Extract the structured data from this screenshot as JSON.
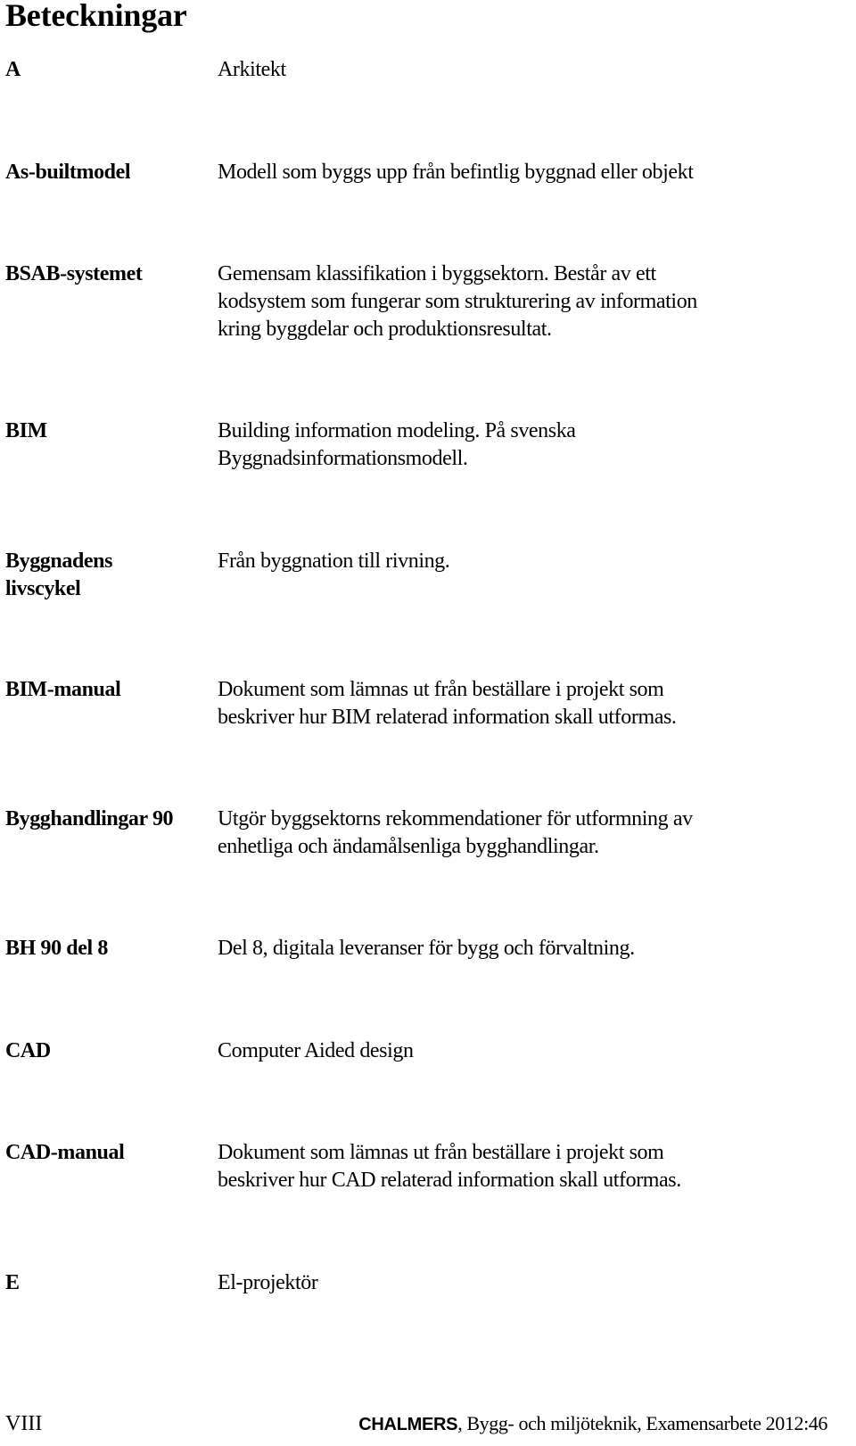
{
  "document": {
    "title": "Beteckningar",
    "entries": [
      {
        "term": "A",
        "definition": "Arkitekt"
      },
      {
        "term": "As-builtmodel",
        "definition": "Modell som byggs upp från befintlig byggnad eller objekt"
      },
      {
        "term": "BSAB-systemet",
        "definition": "Gemensam klassifikation i byggsektorn. Består av ett\nkodsystem som fungerar som strukturering av information\nkring byggdelar och produktionsresultat."
      },
      {
        "term": "BIM",
        "definition": "Building information modeling. På svenska\nByggnadsinformationsmodell."
      },
      {
        "term": "Byggnadens\nlivscykel",
        "definition": "Från byggnation till rivning."
      },
      {
        "term": "BIM-manual",
        "definition": "Dokument som lämnas ut från beställare i projekt som\nbeskriver hur BIM relaterad information skall utformas."
      },
      {
        "term": "Bygghandlingar 90",
        "definition": "Utgör byggsektorns rekommendationer för utformning av\nenhetliga och ändamålsenliga bygghandlingar."
      },
      {
        "term": "BH 90 del 8",
        "definition": "Del 8, digitala leveranser för bygg och förvaltning."
      },
      {
        "term": "CAD",
        "definition": "Computer Aided design"
      },
      {
        "term": "CAD-manual",
        "definition": "Dokument som lämnas ut från beställare i projekt som\nbeskriver hur CAD relaterad  information skall utformas."
      },
      {
        "term": "E",
        "definition": "El-projektör"
      }
    ]
  },
  "footer": {
    "page_number": "VIII",
    "brand": "CHALMERS",
    "text": ", Bygg- och miljöteknik, Examensarbete 2012:46"
  }
}
